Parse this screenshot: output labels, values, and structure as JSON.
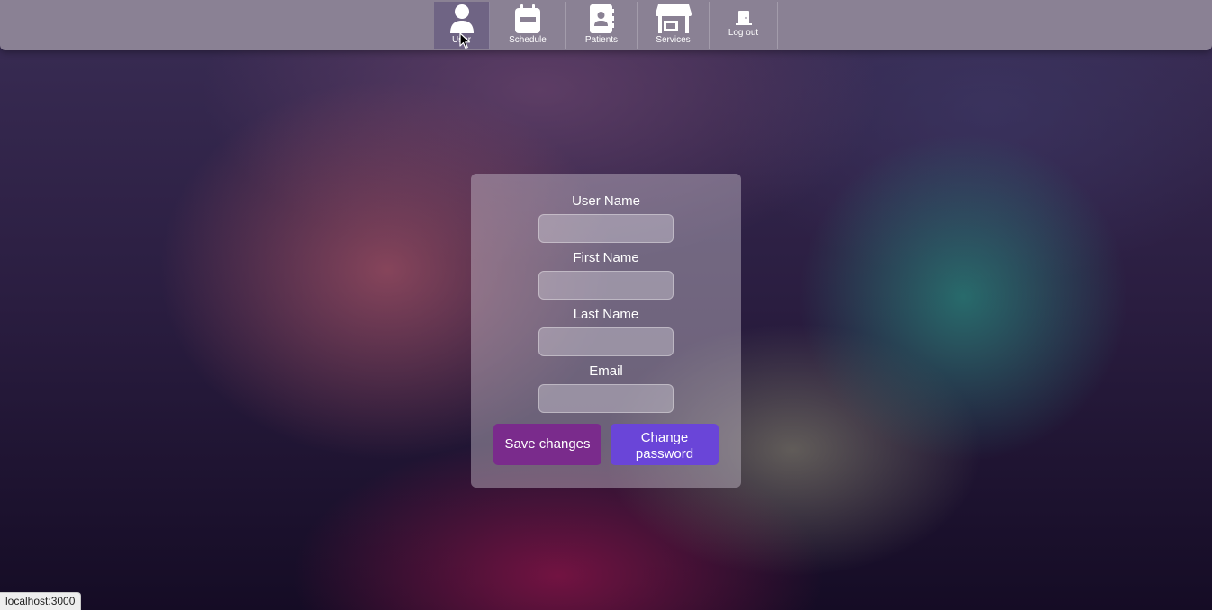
{
  "nav": {
    "items": [
      {
        "label": "User",
        "icon": "user-icon",
        "active": true
      },
      {
        "label": "Schedule",
        "icon": "calendar-icon",
        "active": false
      },
      {
        "label": "Patients",
        "icon": "address-book-icon",
        "active": false
      },
      {
        "label": "Services",
        "icon": "store-icon",
        "active": false
      },
      {
        "label": "Log out",
        "icon": "door-icon",
        "active": false
      }
    ]
  },
  "form": {
    "fields": [
      {
        "label": "User Name",
        "value": "",
        "placeholder": ""
      },
      {
        "label": "First Name",
        "value": "",
        "placeholder": ""
      },
      {
        "label": "Last Name",
        "value": "",
        "placeholder": ""
      },
      {
        "label": "Email",
        "value": "",
        "placeholder": ""
      }
    ],
    "save_label": "Save changes",
    "change_password_label": "Change password"
  },
  "status_bar": {
    "url": "localhost:3000"
  },
  "colors": {
    "topbar": "#8a8194",
    "nav_active": "#6f6484",
    "save_button": "#7a2b8c",
    "change_password_button": "#6a45d8"
  }
}
